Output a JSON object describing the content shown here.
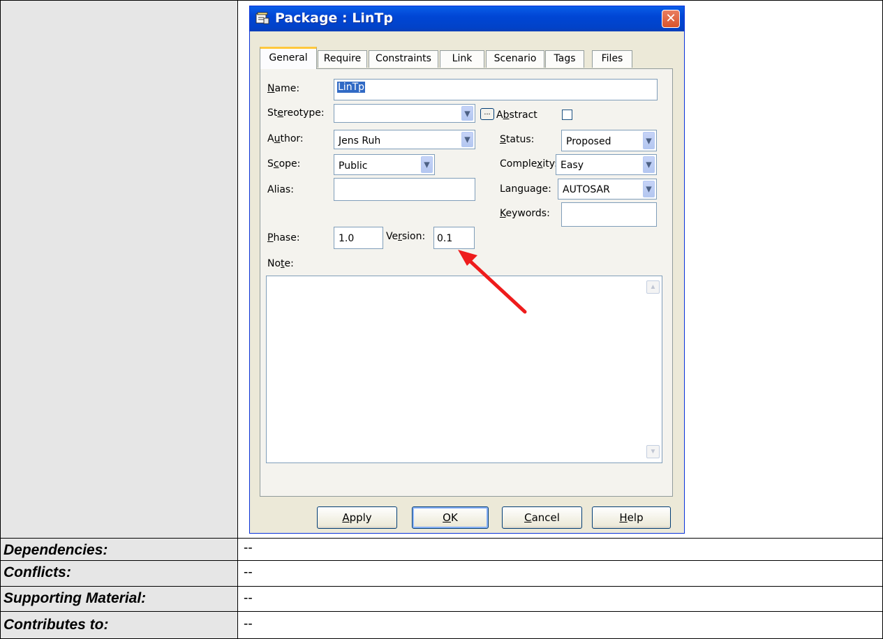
{
  "dialog": {
    "title": "Package : LinTp",
    "close_glyph": "✕",
    "tabs": [
      "General",
      "Require",
      "Constraints",
      "Link",
      "Scenario",
      "Tags",
      "Files"
    ],
    "fields": {
      "name_label_pre": "",
      "name_label_u": "N",
      "name_label_post": "ame:",
      "name_value": "LinTp",
      "stereotype_label_pre": "St",
      "stereotype_label_u": "e",
      "stereotype_label_post": "reotype:",
      "stereotype_value": "",
      "more_glyph": "...",
      "abstract_label_pre": "A",
      "abstract_label_u": "b",
      "abstract_label_post": "stract",
      "abstract_checked": false,
      "author_label_pre": "A",
      "author_label_u": "u",
      "author_label_post": "thor:",
      "author_value": "Jens Ruh",
      "status_label_u": "S",
      "status_label_post": "tatus:",
      "status_value": "Proposed",
      "scope_label_pre": "S",
      "scope_label_u": "c",
      "scope_label_post": "ope:",
      "scope_value": "Public",
      "complexity_label_pre": "Comple",
      "complexity_label_u": "x",
      "complexity_label_post": "ity:",
      "complexity_value": "Easy",
      "alias_label": "Alias:",
      "alias_value": "",
      "language_label": "Language:",
      "language_value": "AUTOSAR",
      "keywords_label_u": "K",
      "keywords_label_post": "eywords:",
      "keywords_value": "",
      "phase_label_pre": "",
      "phase_label_u": "P",
      "phase_label_post": "hase:",
      "phase_value": "1.0",
      "version_label_pre": "Ve",
      "version_label_u": "r",
      "version_label_post": "sion:",
      "version_value": "0.1",
      "note_label_pre": "No",
      "note_label_u": "t",
      "note_label_post": "e:",
      "note_value": ""
    },
    "buttons": {
      "apply_u": "A",
      "apply_post": "pply",
      "ok_u": "O",
      "ok_post": "K",
      "cancel_u": "C",
      "cancel_post": "ancel",
      "help_u": "H",
      "help_post": "elp"
    },
    "scroll_up_glyph": "▲",
    "scroll_down_glyph": "▼",
    "dropdown_glyph": "▼"
  },
  "table": {
    "rows": [
      {
        "label": "Dependencies:",
        "value": "--"
      },
      {
        "label": "Conflicts:",
        "value": "--"
      },
      {
        "label": "Supporting Material:",
        "value": "--"
      },
      {
        "label": "Contributes to:",
        "value": "--"
      }
    ]
  },
  "colors": {
    "annotation_arrow": "#ee1c1c",
    "titlebar": "#0046d5",
    "label_cell_bg": "#e6e6e6"
  },
  "icons": {
    "title": "package-properties-icon",
    "close": "close-icon",
    "annotation": "red-arrow-annotation"
  }
}
